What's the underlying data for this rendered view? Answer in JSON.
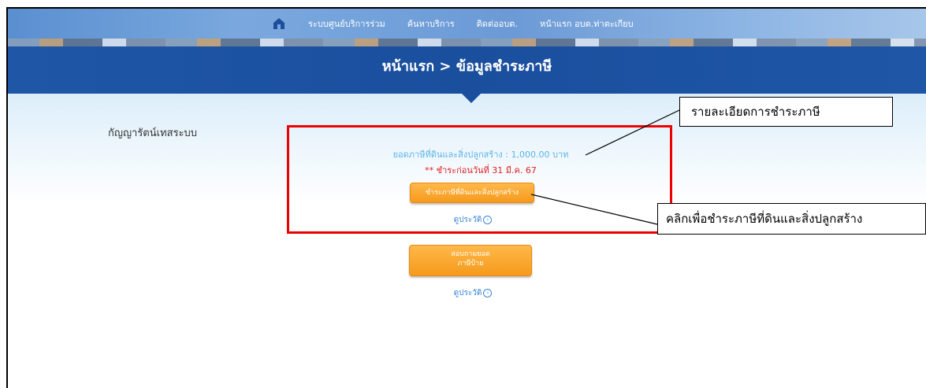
{
  "nav": {
    "items": [
      "ระบบศูนย์บริการร่วม",
      "ค้นหาบริการ",
      "ติดต่ออบต.",
      "หน้าแรก อบต.ท่าตะเกียบ"
    ]
  },
  "header": {
    "title": "หน้าแรก > ข้อมูลชำระภาษี"
  },
  "user": {
    "name": "กัญญารัตน์เทสระบบ"
  },
  "land_tax": {
    "amount_text": "ยอดภาษีที่ดินและสิ่งปลูกสร้าง : 1,000.00 บาท",
    "due_text": "** ชำระก่อนวันที่ 31 มี.ค. 67",
    "pay_button": "ชำระภาษีที่ดินและสิ่งปลูกสร้าง",
    "history_link": "ดูประวัติ"
  },
  "sign_tax": {
    "button_line1": "สอบถามยอด",
    "button_line2": "ภาษีป้าย",
    "history_link": "ดูประวัติ"
  },
  "annotations": {
    "details_label": "รายละเอียดการชำระภาษี",
    "click_label": "คลิกเพื่อชำระภาษีที่ดินและสิ่งปลูกสร้าง"
  },
  "colors": {
    "title_band": "#1a4f9e",
    "button_orange": "#f59a1b",
    "highlight_red": "#ee0000"
  }
}
